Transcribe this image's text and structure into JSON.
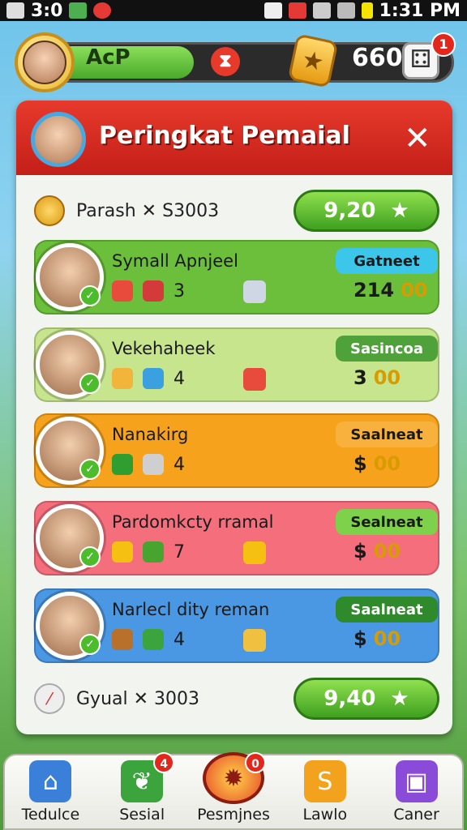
{
  "status_bar": {
    "time": "1:31 PM",
    "left_text": "3:0"
  },
  "hud": {
    "player_name": "AcP",
    "xp_progress": 0.42,
    "timer_icon": "hourglass-icon",
    "coins": "660",
    "notification_count": "1"
  },
  "panel": {
    "title": "Peringkat Pemaial",
    "close_icon": "close-icon",
    "summary_top": {
      "label": "Parash ✕ S3003",
      "button": "9,20"
    },
    "summary_bottom": {
      "label": "Gyual ✕ 3003",
      "button": "9,40"
    }
  },
  "players": [
    {
      "name": "Symall Apnjeel",
      "count": "3",
      "tag": "Gatneet",
      "score": "214",
      "score_hi": "00",
      "color": "#6bbf3a",
      "tag_color": "#3cc6ea",
      "items": [
        "swirl-icon",
        "ruby-icon"
      ],
      "extra": "brick-icon"
    },
    {
      "name": "Vekehaheek",
      "count": "4",
      "tag": "Sasincoa",
      "score": "3",
      "score_hi": "00",
      "color": "#c6e58c",
      "tag_color": "#4fa23a",
      "items": [
        "medal-icon",
        "crystal-icon"
      ],
      "extra": "cupcake-icon"
    },
    {
      "name": "Nanakirg",
      "count": "4",
      "tag": "Saalneat",
      "score": "$",
      "score_hi": "00",
      "color": "#f7a21c",
      "tag_color": "#f7b13c",
      "items": [
        "stool-icon",
        "bulb-icon"
      ],
      "extra": ""
    },
    {
      "name": "Pardomkcty rramal",
      "count": "7",
      "tag": "Sealneat",
      "score": "$",
      "score_hi": "00",
      "color": "#f46e7c",
      "tag_color": "#7ed14b",
      "items": [
        "gold-bar-icon",
        "leaf-icon"
      ],
      "extra": "crate-icon"
    },
    {
      "name": "Narlecl dity reman",
      "count": "4",
      "tag": "Saalneat",
      "score": "$",
      "score_hi": "00",
      "color": "#4a97e4",
      "tag_color": "#2f8a2b",
      "items": [
        "crossed-bones-icon",
        "frog-icon"
      ],
      "extra": "lollipop-icon"
    }
  ],
  "nav": [
    {
      "label": "Tedulce",
      "icon": "house-icon",
      "badge": ""
    },
    {
      "label": "Sesial",
      "icon": "leaf-icon",
      "badge": "4"
    },
    {
      "label": "Pesmjnes",
      "icon": "sun-gear-icon",
      "badge": "0"
    },
    {
      "label": "Lawlo",
      "icon": "s-badge-icon",
      "badge": ""
    },
    {
      "label": "Caner",
      "icon": "purple-box-icon",
      "badge": ""
    }
  ]
}
